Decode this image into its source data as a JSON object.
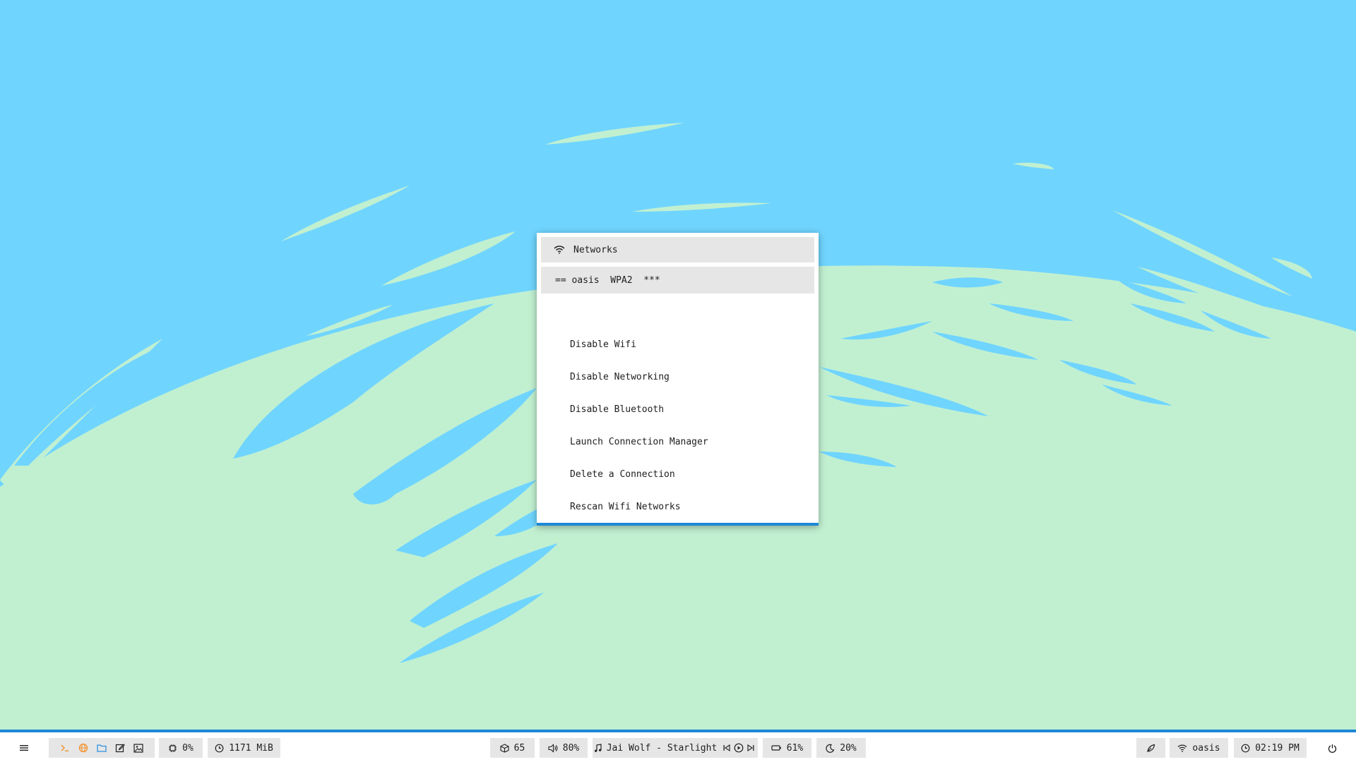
{
  "menu": {
    "header_label": "Networks",
    "network_row": "== oasis  WPA2  ***",
    "items": [
      "Disable Wifi",
      "Disable Networking",
      "Disable Bluetooth",
      "Launch Connection Manager",
      "Delete a Connection",
      "Rescan Wifi Networks"
    ]
  },
  "bar": {
    "cpu": "0%",
    "memory": "1171 MiB",
    "updates": "65",
    "volume": "80%",
    "now_playing": "Jai Wolf - Starlight",
    "battery": "61%",
    "brightness": "20%",
    "wifi": "oasis",
    "clock": "02:19 PM"
  },
  "colors": {
    "sky": "#70d5fe",
    "ground": "#c1f0d1",
    "accent": "#1e88d6",
    "module_bg": "#e6e6e6",
    "launcher_terminal": "#f0922c",
    "launcher_browser": "#f0922c",
    "launcher_files": "#2d8fe0"
  },
  "icons": {
    "menu": "hamburger-icon",
    "wifi": "wifi-icon",
    "cpu": "cpu-icon",
    "memory": "clock-icon",
    "updates": "package-icon",
    "volume": "speaker-icon",
    "music": "music-note-icon",
    "battery": "battery-icon",
    "brightness": "moon-icon",
    "power": "power-icon"
  }
}
